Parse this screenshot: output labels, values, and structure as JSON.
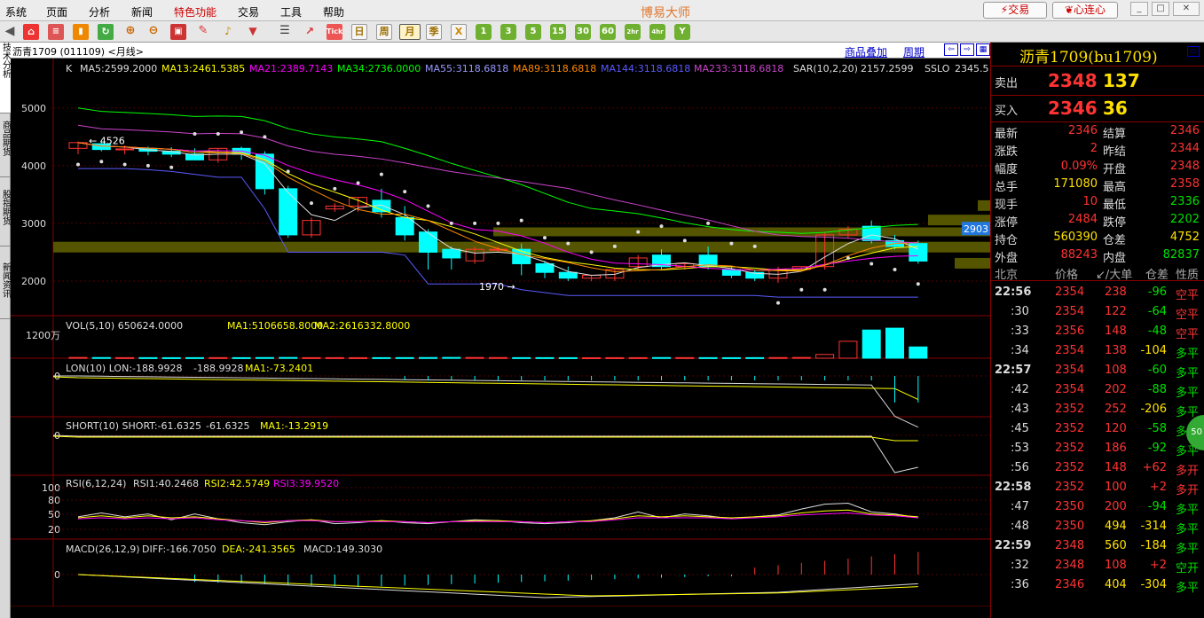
{
  "menu": [
    "系统",
    "页面",
    "分析",
    "新闻",
    "特色功能",
    "交易",
    "工具",
    "帮助"
  ],
  "app_title": "博易大师",
  "buttons": {
    "trade": "交易",
    "heart": "心连心"
  },
  "toolbar_periods": [
    "Tick",
    "日",
    "周",
    "月",
    "季",
    "X",
    "1",
    "3",
    "5",
    "15",
    "30",
    "60",
    "2hr",
    "4hr",
    "Y"
  ],
  "left_tabs": [
    "技术分析",
    "商品期货",
    "股指期货",
    "新闻资讯"
  ],
  "header": {
    "symbol": "沥青1709 (011109) <月线>",
    "overlay": "商品叠加",
    "period": "周期"
  },
  "indicators": {
    "k": "K",
    "ma5": "MA5:2599.2000",
    "ma13": "MA13:2461.5385",
    "ma21": "MA21:2389.7143",
    "ma34": "MA34:2736.0000",
    "ma55": "MA55:3118.6818",
    "ma89": "MA89:3118.6818",
    "ma144": "MA144:3118.6818",
    "ma233": "MA233:3118.6818",
    "sar": "SAR(10,2,20)",
    "sar_v": "2157.2599",
    "sslo": "SSLO",
    "sslo_v": "2345.5",
    "vol": "VOL(5,10) 650624.0000",
    "vol_ma1": "MA1:5106658.8000",
    "vol_ma2": "MA2:2616332.8000",
    "vol_axis": "1200万",
    "lon": "LON(10) LON:-188.9928",
    "lon_v": "-188.9928",
    "lon_ma": "MA1:-73.2401",
    "short": "SHORT(10) SHORT:-61.6325",
    "short_v": "-61.6325",
    "short_ma": "MA1:-13.2919",
    "rsi": "RSI(6,12,24)",
    "rsi1": "RSI1:40.2468",
    "rsi2": "RSI2:42.5749",
    "rsi3": "RSI3:39.9520",
    "macd": "MACD(26,12,9)",
    "diff": "DIFF:-166.7050",
    "dea": "DEA:-241.3565",
    "macd_v": "MACD:149.3030"
  },
  "chart_data": {
    "type": "candlestick",
    "period": "月线",
    "y_axis": [
      5000,
      4000,
      3000,
      2000
    ],
    "annotations": {
      "high": "4526",
      "low": "1970",
      "price_tag": "2903"
    },
    "ohlc": [
      [
        4300,
        4420,
        4200,
        4400
      ],
      [
        4380,
        4450,
        4250,
        4280
      ],
      [
        4280,
        4350,
        4200,
        4290
      ],
      [
        4300,
        4330,
        4180,
        4250
      ],
      [
        4250,
        4320,
        4150,
        4200
      ],
      [
        4200,
        4300,
        4100,
        4100
      ],
      [
        4100,
        4300,
        4050,
        4300
      ],
      [
        4300,
        4330,
        4100,
        4200
      ],
      [
        4200,
        4250,
        3500,
        3600
      ],
      [
        3600,
        3650,
        2750,
        2800
      ],
      [
        2800,
        3100,
        2750,
        3050
      ],
      [
        3250,
        3350,
        3200,
        3300
      ],
      [
        3300,
        3450,
        3200,
        3450
      ],
      [
        3400,
        3600,
        3100,
        3200
      ],
      [
        3100,
        3300,
        2700,
        2800
      ],
      [
        2850,
        2900,
        2200,
        2500
      ],
      [
        2550,
        2600,
        2200,
        2400
      ],
      [
        2350,
        2600,
        2300,
        2550
      ],
      [
        2550,
        2600,
        2500,
        2550
      ],
      [
        2550,
        2650,
        2100,
        2300
      ],
      [
        2300,
        2350,
        2050,
        2150
      ],
      [
        2150,
        2250,
        2000,
        2050
      ],
      [
        2050,
        2100,
        2000,
        2100
      ],
      [
        2050,
        2200,
        2000,
        2200
      ],
      [
        2250,
        2450,
        2200,
        2400
      ],
      [
        2450,
        2550,
        2200,
        2250
      ],
      [
        2250,
        2300,
        2200,
        2300
      ],
      [
        2450,
        2600,
        2200,
        2250
      ],
      [
        2200,
        2250,
        2050,
        2100
      ],
      [
        2150,
        2200,
        2000,
        2050
      ],
      [
        2050,
        2250,
        1970,
        2200
      ],
      [
        2200,
        2250,
        2200,
        2250
      ],
      [
        2250,
        2850,
        2200,
        2800
      ],
      [
        2800,
        2950,
        2750,
        2900
      ],
      [
        2950,
        3050,
        2650,
        2700
      ],
      [
        2700,
        2800,
        2550,
        2600
      ],
      [
        2650,
        2700,
        2300,
        2346
      ]
    ],
    "volume": [
      40,
      35,
      30,
      30,
      28,
      30,
      32,
      30,
      35,
      38,
      30,
      30,
      28,
      30,
      32,
      35,
      40,
      38,
      35,
      30,
      30,
      28,
      26,
      28,
      30,
      35,
      32,
      30,
      28,
      30,
      35,
      40,
      200,
      900,
      1500,
      1600,
      600
    ]
  },
  "quote": {
    "title": "沥青1709(bu1709)",
    "sell_label": "卖出",
    "sell_price": "2348",
    "sell_vol": "137",
    "buy_label": "买入",
    "buy_price": "2346",
    "buy_vol": "36",
    "rows": [
      [
        "最新",
        "2346",
        "结算",
        "2346"
      ],
      [
        "涨跌",
        "2",
        "昨结",
        "2344"
      ],
      [
        "幅度",
        "0.09%",
        "开盘",
        "2348"
      ],
      [
        "总手",
        "171080",
        "最高",
        "2358"
      ],
      [
        "现手",
        "10",
        "最低",
        "2336"
      ],
      [
        "涨停",
        "2484",
        "跌停",
        "2202"
      ],
      [
        "持仓",
        "560390",
        "仓差",
        "4752"
      ],
      [
        "外盘",
        "88243",
        "内盘",
        "82837"
      ]
    ],
    "tick_header": [
      "北京",
      "价格",
      "↙/大单",
      "仓差",
      "性质"
    ],
    "ticks": [
      [
        "22:56",
        "2354",
        "238",
        "-96",
        "空平"
      ],
      [
        ":30",
        "2354",
        "122",
        "-64",
        "空平"
      ],
      [
        ":33",
        "2356",
        "148",
        "-48",
        "空平"
      ],
      [
        ":34",
        "2354",
        "138",
        "-104",
        "多平"
      ],
      [
        "22:57",
        "2354",
        "108",
        "-60",
        "多平"
      ],
      [
        ":42",
        "2354",
        "202",
        "-88",
        "多平"
      ],
      [
        ":43",
        "2352",
        "252",
        "-206",
        "多平"
      ],
      [
        ":45",
        "2352",
        "120",
        "-58",
        "多平"
      ],
      [
        ":53",
        "2352",
        "186",
        "-92",
        "多平"
      ],
      [
        ":56",
        "2352",
        "148",
        "+62",
        "多开"
      ],
      [
        "22:58",
        "2352",
        "100",
        "+2",
        "多开"
      ],
      [
        ":47",
        "2350",
        "200",
        "-94",
        "多平"
      ],
      [
        ":48",
        "2350",
        "494",
        "-314",
        "多平"
      ],
      [
        "22:59",
        "2348",
        "560",
        "-184",
        "多平"
      ],
      [
        ":32",
        "2348",
        "108",
        "+2",
        "空开"
      ],
      [
        ":36",
        "2346",
        "404",
        "-304",
        "多平"
      ]
    ]
  }
}
